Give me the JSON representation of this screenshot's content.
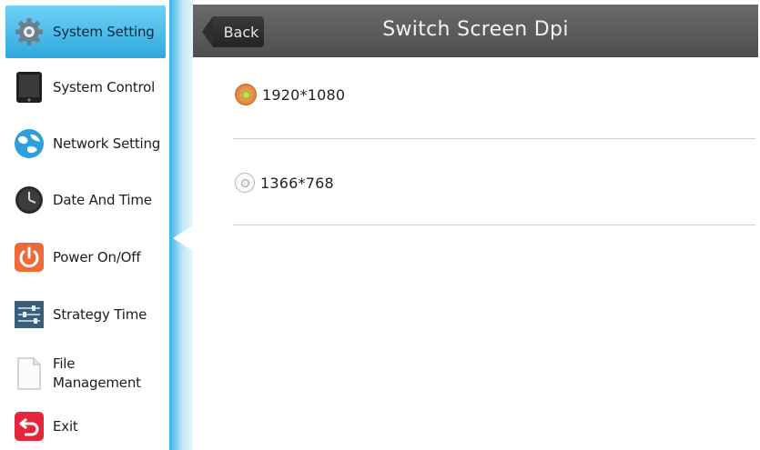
{
  "sidebar": {
    "items": [
      {
        "label": "System Setting",
        "icon": "gear-icon",
        "active": true
      },
      {
        "label": "System Control",
        "icon": "tablet-icon",
        "active": false
      },
      {
        "label": "Network Setting",
        "icon": "globe-icon",
        "active": false
      },
      {
        "label": "Date And Time",
        "icon": "clock-icon",
        "active": false
      },
      {
        "label": "Power On/Off",
        "icon": "power-icon",
        "active": false
      },
      {
        "label": "Strategy Time",
        "icon": "sliders-icon",
        "active": false
      },
      {
        "label": "File Management",
        "label_line1": "File",
        "label_line2": "Management",
        "icon": "file-icon",
        "active": false
      },
      {
        "label": "Exit",
        "icon": "exit-icon",
        "active": false
      }
    ]
  },
  "header": {
    "back_label": "Back",
    "title": "Switch Screen Dpi"
  },
  "options": [
    {
      "label": "1920*1080",
      "selected": true
    },
    {
      "label": "1366*768",
      "selected": false
    }
  ],
  "colors": {
    "active_item": "#3fb4e4",
    "header_bg": "#5a5a5a",
    "radio_selected": "#e48a3f"
  }
}
